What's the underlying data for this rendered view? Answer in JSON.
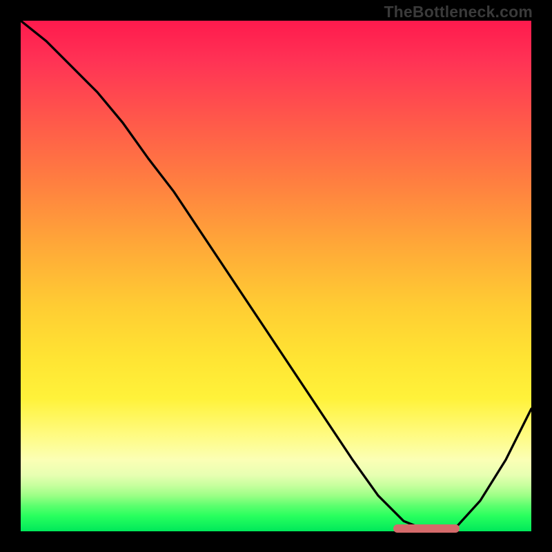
{
  "watermark": "TheBottleneck.com",
  "colors": {
    "gradient_top": "#ff1a4d",
    "gradient_mid": "#ffe433",
    "gradient_bottom": "#00e85a",
    "curve": "#000000",
    "marker": "#d46a6a",
    "frame_bg": "#000000"
  },
  "chart_data": {
    "type": "line",
    "title": "",
    "xlabel": "",
    "ylabel": "",
    "xlim": [
      0,
      100
    ],
    "ylim": [
      0,
      100
    ],
    "grid": false,
    "series": [
      {
        "name": "curve",
        "x": [
          0,
          5,
          10,
          15,
          20,
          25,
          30,
          35,
          40,
          45,
          50,
          55,
          60,
          65,
          70,
          75,
          80,
          85,
          90,
          95,
          100
        ],
        "y": [
          100,
          96,
          91,
          86,
          80,
          73,
          66.5,
          59,
          51.5,
          44,
          36.5,
          29,
          21.5,
          14,
          7,
          2,
          0,
          0.5,
          6,
          14,
          24
        ]
      }
    ],
    "annotations": [
      {
        "kind": "marker-bar",
        "x_start": 73,
        "x_end": 86,
        "y": 0.5
      }
    ]
  }
}
